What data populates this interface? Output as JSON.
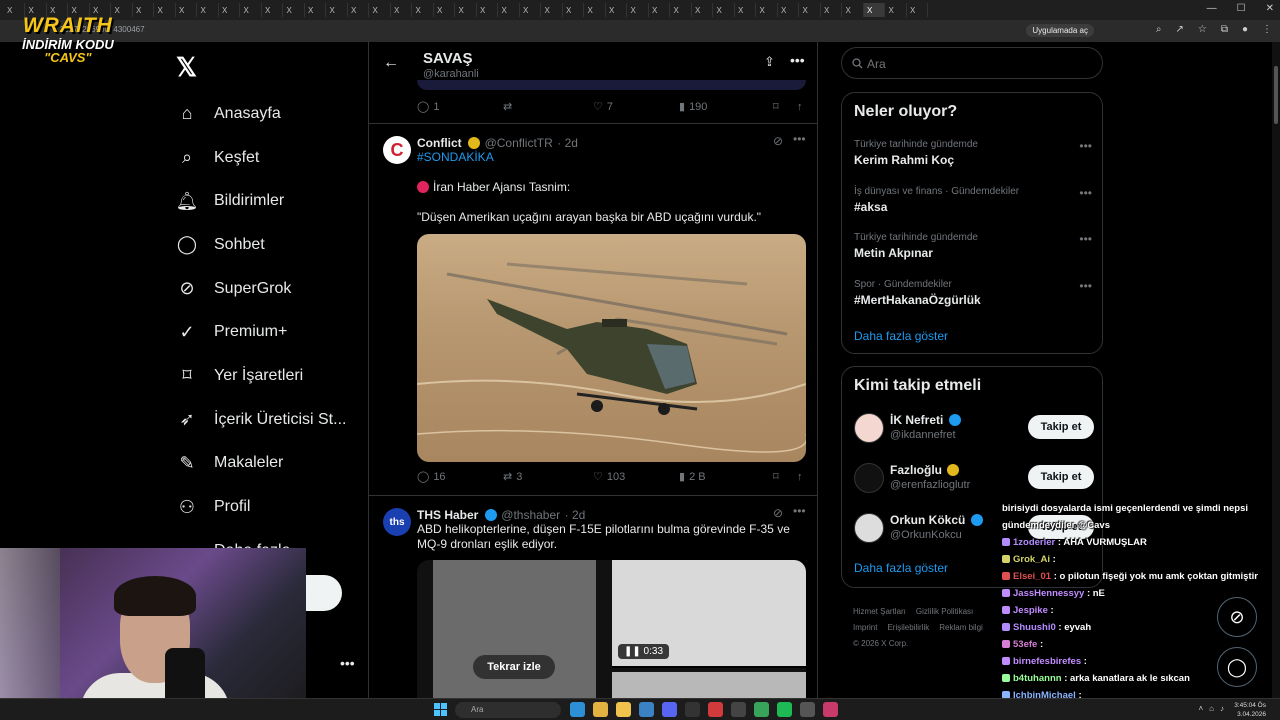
{
  "browser": {
    "url": "x.com/karahanli/status/2027822690074300467",
    "url_visible": "2027822690074300467",
    "app_chip": "Uygulamada aç",
    "tab_letter": "X",
    "tab_count": 43
  },
  "overlay": {
    "brand": "WRAITH",
    "code_label": "İNDİRİM KODU",
    "code": "\"CAVS\""
  },
  "nav": {
    "items": [
      {
        "label": "Anasayfa",
        "icon": "home-icon"
      },
      {
        "label": "Keşfet",
        "icon": "search-icon"
      },
      {
        "label": "Bildirimler",
        "icon": "bell-icon"
      },
      {
        "label": "Sohbet",
        "icon": "chat-icon"
      },
      {
        "label": "SuperGrok",
        "icon": "grok-icon"
      },
      {
        "label": "Premium+",
        "icon": "verified-icon"
      },
      {
        "label": "Yer İşaretleri",
        "icon": "bookmark-icon"
      },
      {
        "label": "İçerik Üreticisi St...",
        "icon": "rocket-icon"
      },
      {
        "label": "Makaleler",
        "icon": "article-icon"
      },
      {
        "label": "Profil",
        "icon": "person-icon"
      },
      {
        "label": "Daha fazla",
        "icon": "more-circle-icon"
      }
    ]
  },
  "header": {
    "title": "SAVAŞ",
    "handle": "@karahanli"
  },
  "prev_tweet": {
    "replies": "1",
    "likes": "7",
    "views": "190"
  },
  "tweet1": {
    "name": "Conflict",
    "handle": "@ConflictTR",
    "time": "· 2d",
    "hashtag": "#SONDAKİKA",
    "line1": "İran Haber Ajansı Tasnim:",
    "line2": "\"Düşen Amerikan uçağını arayan başka bir ABD uçağını vurduk.\"",
    "replies": "16",
    "reposts": "3",
    "likes": "103",
    "views": "2 B"
  },
  "tweet2": {
    "name": "THS Haber",
    "handle": "@thshaber",
    "time": "· 2d",
    "avatar_text": "ths",
    "text": "ABD helikopterlerine, düşen F-15E pilotlarını bulma görevinde F-35 ve MQ-9 dronları eşlik ediyor.",
    "replay": "Tekrar izle",
    "duration": "0:33"
  },
  "search": {
    "placeholder": "Ara"
  },
  "trends": {
    "title": "Neler oluyor?",
    "items": [
      {
        "meta": "Türkiye tarihinde gündemde",
        "topic": "Kerim Rahmi Koç"
      },
      {
        "meta": "İş dünyası ve finans · Gündemdekiler",
        "topic": "#aksa"
      },
      {
        "meta": "Türkiye tarihinde gündemde",
        "topic": "Metin Akpınar"
      },
      {
        "meta": "Spor · Gündemdekiler",
        "topic": "#MertHakanaÖzgürlük"
      }
    ],
    "show_more": "Daha fazla göster"
  },
  "who_to_follow": {
    "title": "Kimi takip etmeli",
    "users": [
      {
        "name": "İK Nefreti",
        "handle": "@ikdannefret",
        "button": "Takip et"
      },
      {
        "name": "Fazlıoğlu",
        "handle": "@erenfazlioglutr",
        "button": "Takip et"
      },
      {
        "name": "Orkun Kökcü",
        "handle": "@OrkunKokcu",
        "button": "Takip et"
      }
    ],
    "show_more": "Daha fazla göster"
  },
  "footer": {
    "links": [
      "Hizmet Şartları",
      "Gizlilik Politikası",
      "Imprint",
      "Erişilebilirlik",
      "Reklam bilgi"
    ],
    "copyright": "© 2026 X Corp."
  },
  "chat": [
    {
      "user": "",
      "text": "birisiydi dosyalarda ismi geçenlerdendi ve şimdi nepsi",
      "color": "#ffffff"
    },
    {
      "user": "",
      "text": "gündemdeydiler @Cavs",
      "color": "#ffffff"
    },
    {
      "user": "1zoderler",
      "text": ": AHA VURMUŞLAR",
      "color": "#b38cff"
    },
    {
      "user": "Grok_Ai",
      "text": ":",
      "color": "#d4d46a"
    },
    {
      "user": "Elsei_01",
      "text": ": o pilotun fişeği yok mu amk çoktan gitmiştir",
      "color": "#e05050"
    },
    {
      "user": "JassHennessyy",
      "text": ": nE",
      "color": "#c18cff"
    },
    {
      "user": "Jespike",
      "text": ":",
      "color": "#c18cff"
    },
    {
      "user": "Shuushi0",
      "text": ": eyvah",
      "color": "#b38cff"
    },
    {
      "user": "53efe",
      "text": ":",
      "color": "#d67fd6"
    },
    {
      "user": "birnefesbirefes",
      "text": ":",
      "color": "#c18cff"
    },
    {
      "user": "b4tuhannn",
      "text": ": arka kanatlara ak le sıkcan",
      "color": "#9aff9a"
    },
    {
      "user": "IchbinMichael",
      "text": ":",
      "color": "#8ab4ff"
    }
  ],
  "taskbar": {
    "search": "Ara",
    "time": "3:45:04 Ös",
    "date": "3.04.2026"
  },
  "colors": {
    "accent": "#1d9bf0",
    "gold": "#f5c518",
    "bg": "#000000",
    "border": "#2f3336"
  }
}
